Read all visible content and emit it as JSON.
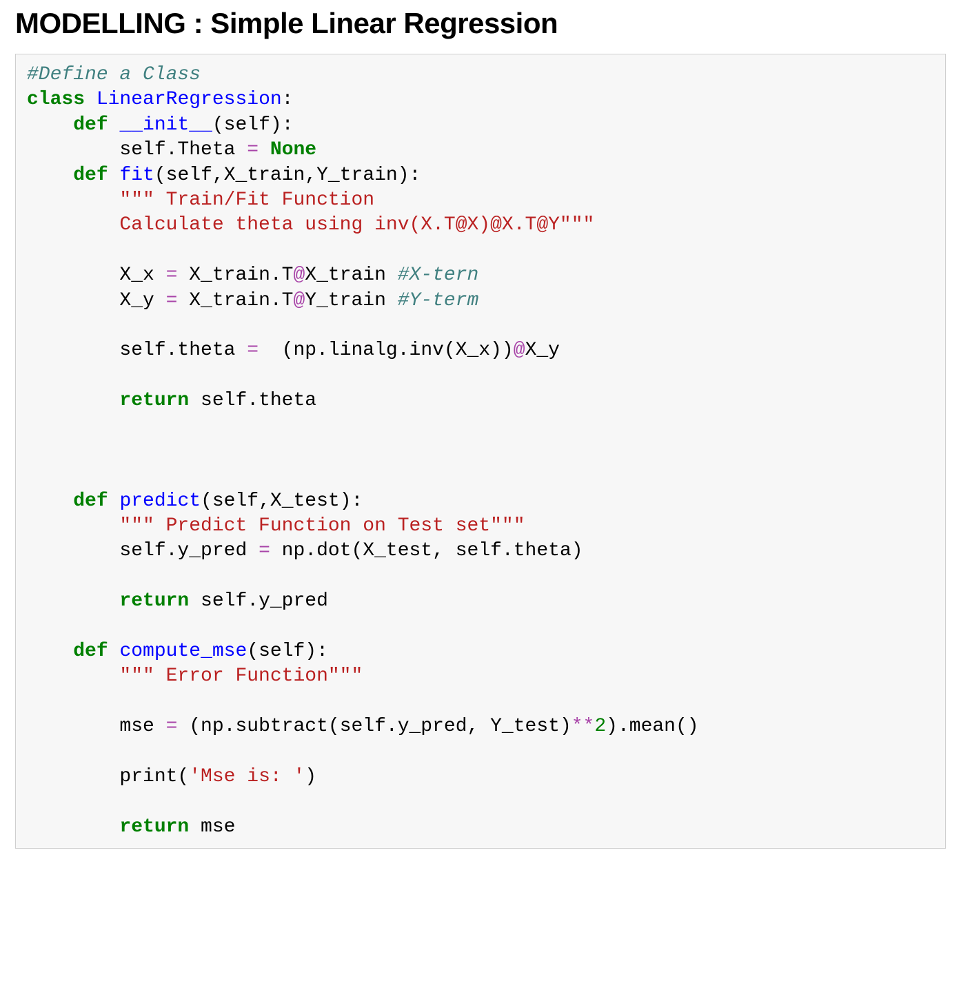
{
  "heading": "MODELLING : Simple Linear Regression",
  "code": {
    "comment_define": "#Define a Class",
    "kw_class": "class",
    "class_name": "LinearRegression",
    "colon": ":",
    "kw_def": "def",
    "fn_init": "__init__",
    "sig_self": "(self):",
    "init_body_1a": "        self.Theta ",
    "op_eq": "=",
    "none_kw": "None",
    "fn_fit": "fit",
    "sig_fit": "(self,X_train,Y_train):",
    "fit_doc_open": "\"\"\" Train/Fit Function",
    "fit_doc_line2": "        Calculate theta using inv(X.T@X)@X.T@Y\"\"\"",
    "fit_xx_lhs": "        X_x ",
    "fit_xx_rhs_a": " X_train.T",
    "at": "@",
    "fit_xx_rhs_b": "X_train ",
    "cm_xtern": "#X-tern",
    "fit_xy_lhs": "        X_y ",
    "fit_xy_rhs_a": " X_train.T",
    "fit_xy_rhs_b": "Y_train ",
    "cm_yterm": "#Y-term",
    "fit_theta_lhs": "        self.theta ",
    "fit_theta_rhs_a": "  (np.linalg.inv(X_x))",
    "fit_theta_rhs_b": "X_y",
    "kw_return": "return",
    "fit_return_val": " self.theta",
    "fn_predict": "predict",
    "sig_predict": "(self,X_test):",
    "predict_doc": "\"\"\" Predict Function on Test set\"\"\"",
    "predict_body_lhs": "        self.y_pred ",
    "predict_body_rhs": " np.dot(X_test, self.theta)",
    "predict_return_val": " self.y_pred",
    "fn_mse": "compute_mse",
    "sig_mse": "(self):",
    "mse_doc": "\"\"\" Error Function\"\"\"",
    "mse_body_lhs": "        mse ",
    "mse_body_rhs_a": " (np.subtract(self.y_pred, Y_test)",
    "op_pow": "**",
    "num_2": "2",
    "mse_body_rhs_b": ").mean()",
    "mse_print_a": "        print(",
    "mse_print_str": "'Mse is: '",
    "mse_print_b": ")",
    "mse_return_val": " mse",
    "indent4": "    ",
    "indent8": "        ",
    "space": " "
  }
}
